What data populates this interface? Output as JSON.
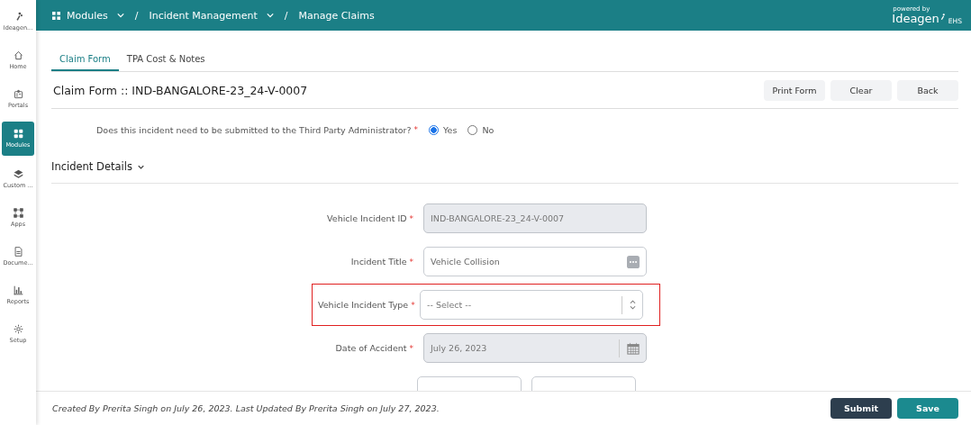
{
  "sidebar": {
    "items": [
      {
        "label": "Ideagen...",
        "selected": false
      },
      {
        "label": "Home",
        "selected": false
      },
      {
        "label": "Portals",
        "selected": false
      },
      {
        "label": "Modules",
        "selected": true
      },
      {
        "label": "Custom ...",
        "selected": false
      },
      {
        "label": "Apps",
        "selected": false
      },
      {
        "label": "Docume...",
        "selected": false
      },
      {
        "label": "Reports",
        "selected": false
      },
      {
        "label": "Setup",
        "selected": false
      }
    ]
  },
  "breadcrumb": [
    {
      "label": "Modules",
      "dropdown": true
    },
    {
      "label": "Incident Management",
      "dropdown": true
    },
    {
      "label": "Manage Claims",
      "dropdown": false
    }
  ],
  "breadcrumb_separators": [
    "/",
    "/"
  ],
  "required_mark": "*",
  "brand": {
    "powered_by": "powered by",
    "name": "Ideagen",
    "suffix": "EHS"
  },
  "tabs": [
    {
      "label": "Claim Form",
      "selected": true
    },
    {
      "label": "TPA Cost & Notes",
      "selected": false
    }
  ],
  "page_title": "Claim Form :: IND-BANGALORE-23_24-V-0007",
  "actions": [
    "Print Form",
    "Clear",
    "Back"
  ],
  "question": {
    "text": "Does this incident need to be submitted to the Third Party Administrator?",
    "required": true,
    "options": [
      {
        "label": "Yes",
        "selected": true
      },
      {
        "label": "No",
        "selected": false
      }
    ]
  },
  "section": {
    "title": "Incident Details",
    "expanded": true
  },
  "fields": [
    {
      "label": "Vehicle Incident ID",
      "required": true,
      "kind": "text",
      "value": "IND-BANGALORE-23_24-V-0007",
      "disabled": true,
      "highlighted": false
    },
    {
      "label": "Incident Title",
      "required": true,
      "kind": "textmore",
      "value": "Vehicle Collision",
      "disabled": false,
      "highlighted": false
    },
    {
      "label": "Vehicle Incident Type",
      "required": true,
      "kind": "select",
      "placeholder": "-- Select --",
      "disabled": false,
      "highlighted": true
    },
    {
      "label": "Date of Accident",
      "required": true,
      "kind": "date",
      "value": "July 26, 2023",
      "disabled": true,
      "highlighted": false
    },
    {
      "kind": "time",
      "required": false,
      "highlighted": false
    }
  ],
  "footer": {
    "note": "Created By Prerita Singh on July 26, 2023. Last Updated By Prerita Singh on July 27, 2023.",
    "buttons": [
      {
        "label": "Submit",
        "kind": "dark"
      },
      {
        "label": "Save",
        "kind": "primary"
      }
    ]
  }
}
